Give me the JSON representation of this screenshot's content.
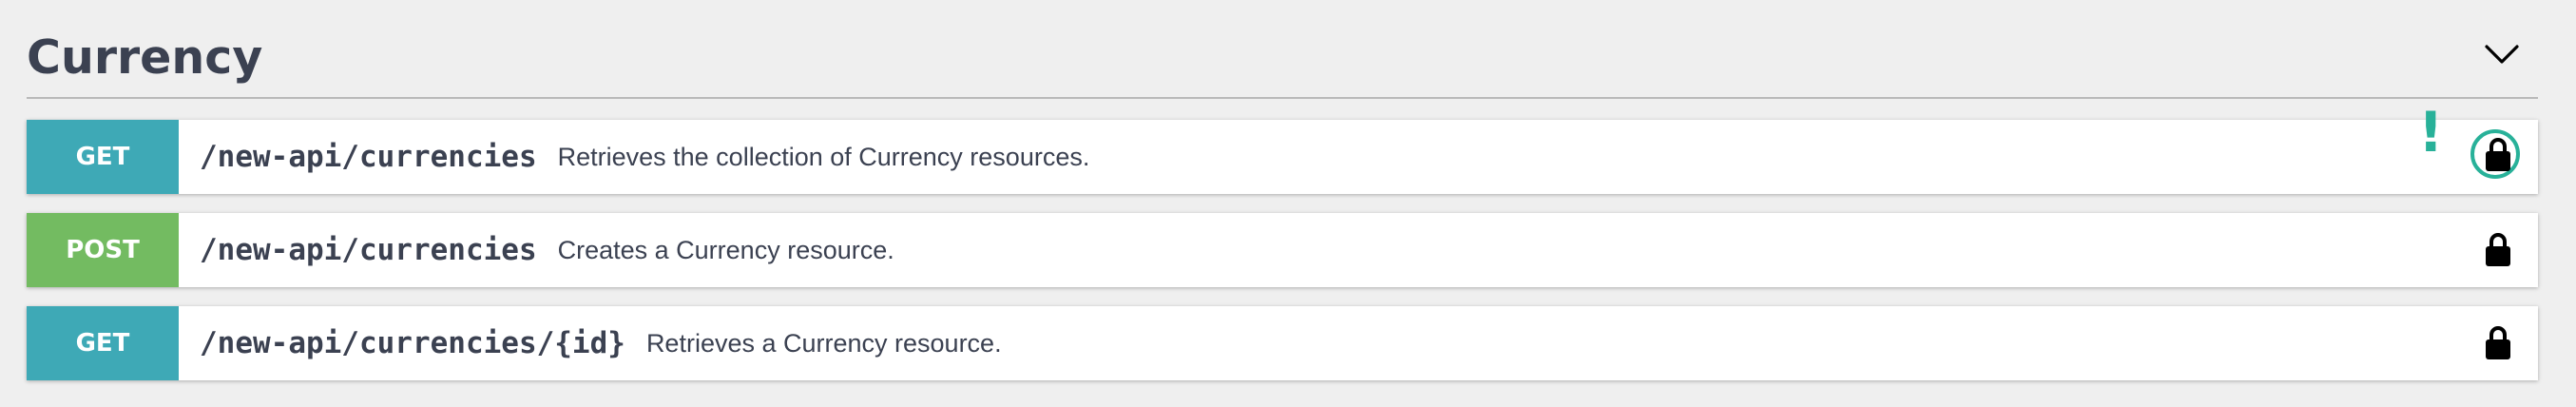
{
  "section": {
    "title": "Currency",
    "toggle_icon": "chevron-down-icon"
  },
  "operations": [
    {
      "method": "GET",
      "method_color": "#3ea9b6",
      "path": "/new-api/currencies",
      "summary": "Retrieves the collection of Currency resources.",
      "lock_icon": "lock-icon",
      "focused": true,
      "alert_text": "!"
    },
    {
      "method": "POST",
      "method_color": "#73bb61",
      "path": "/new-api/currencies",
      "summary": "Creates a Currency resource.",
      "lock_icon": "lock-icon",
      "focused": false
    },
    {
      "method": "GET",
      "method_color": "#3ea9b6",
      "path": "/new-api/currencies/{id}",
      "summary": "Retrieves a Currency resource.",
      "lock_icon": "lock-icon",
      "focused": false
    }
  ],
  "colors": {
    "title": "#3b4151",
    "accent_focus": "#28b199",
    "background": "#efefef"
  }
}
